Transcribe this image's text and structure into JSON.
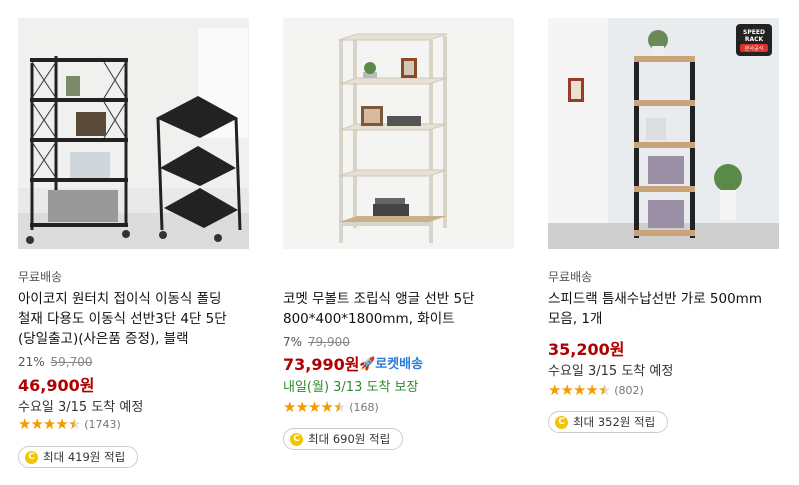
{
  "products": [
    {
      "shipping": "무료배송",
      "title_lines": [
        "아이코지 원터치 접이식 이동식 폴딩",
        "철재 다용도 이동식 선반3단 4단 5단",
        "(당일출고)(사은품 증정), 블랙"
      ],
      "discount": "21%",
      "original_price": "59,700",
      "price": "46,900원",
      "delivery": "수요일 3/15 도착 예정",
      "rating": 4.5,
      "review_count": "(1743)",
      "reward_coin": "C",
      "reward": "최대 419원 적립"
    },
    {
      "shipping": "",
      "title_lines": [
        "코멧 무볼트 조립식 앵글 선반 5단",
        "800*400*1800mm, 화이트"
      ],
      "discount": "7%",
      "original_price": "79,900",
      "price": "73,990원",
      "rocket": "로켓배송",
      "delivery": "내일(월) 3/13 도착 보장",
      "rating": 4.5,
      "review_count": "(168)",
      "reward_coin": "C",
      "reward": "최대 690원 적립"
    },
    {
      "shipping": "무료배송",
      "title_lines": [
        "스피드랙 틈새수납선반 가로 500mm",
        "모음, 1개"
      ],
      "price": "35,200원",
      "delivery": "수요일 3/15 도착 예정",
      "rating": 4.5,
      "review_count": "(802)",
      "reward_coin": "C",
      "reward": "최대 352원 적립",
      "badge_lines": [
        "SPEED",
        "RACK",
        "본사공식"
      ]
    }
  ],
  "colors": {
    "price": "#ae0000",
    "rocket": "#2b7bda",
    "guarantee": "#2e8a2e",
    "star": "#f59b00"
  },
  "icons": [
    "star-icon",
    "rocket-icon",
    "coin-icon"
  ]
}
